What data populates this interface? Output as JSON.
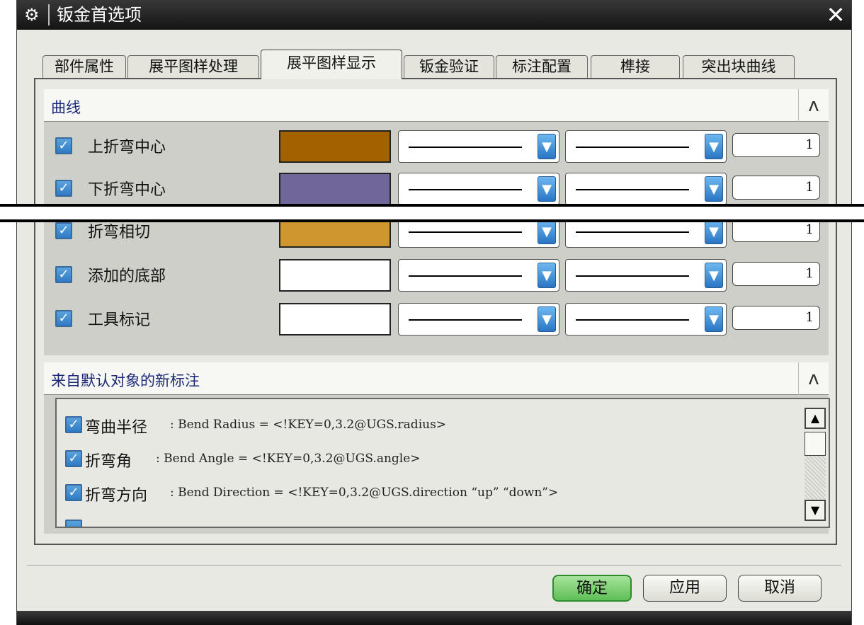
{
  "window": {
    "title": "钣金首选项",
    "close_glyph": "✕",
    "settings_glyph": "⚙"
  },
  "tabs": [
    {
      "label": "部件属性"
    },
    {
      "label": "展平图样处理"
    },
    {
      "label": "展平图样显示",
      "active": true
    },
    {
      "label": "钣金验证"
    },
    {
      "label": "标注配置"
    },
    {
      "label": "榫接"
    },
    {
      "label": "突出块曲线"
    }
  ],
  "curves_section": {
    "title": "曲线",
    "collapse_glyph": "ʌ",
    "rows": [
      {
        "label": "上折弯中心",
        "checked": true,
        "color": "#a26200",
        "width": "1"
      },
      {
        "label": "下折弯中心",
        "checked": true,
        "color": "#716699",
        "width": "1"
      },
      {
        "label": "折弯相切",
        "checked": true,
        "color": "#cf952f",
        "width": "1"
      },
      {
        "label": "添加的底部",
        "checked": true,
        "color": "#ffffff",
        "width": "1"
      },
      {
        "label": "工具标记",
        "checked": true,
        "color": "#ffffff",
        "width": "1"
      }
    ]
  },
  "annotations_section": {
    "title": "来自默认对象的新标注",
    "collapse_glyph": "ʌ",
    "items": [
      {
        "label": "弯曲半径",
        "text": ": Bend Radius = <!KEY=0,3.2@UGS.radius>",
        "checked": true
      },
      {
        "label": "折弯角",
        "text": ": Bend Angle = <!KEY=0,3.2@UGS.angle>",
        "checked": true
      },
      {
        "label": "折弯方向",
        "text": ": Bend Direction = <!KEY=0,3.2@UGS.direction “up” “down”>",
        "checked": true
      }
    ],
    "scroll_up_glyph": "▲",
    "scroll_down_glyph": "▼"
  },
  "buttons": {
    "ok": "确定",
    "apply": "应用",
    "cancel": "取消"
  },
  "colors": {
    "accent_check": "#2f7ac4",
    "ok_button": "#5fbf55",
    "titlebar": "#1e1e1e"
  },
  "check_glyph": "✓",
  "dropdown_arrow_glyph": "▼"
}
